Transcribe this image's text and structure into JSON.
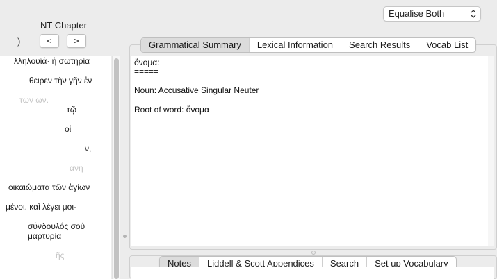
{
  "left": {
    "chapter_title": "NT Chapter",
    "chapter_prefix": ")",
    "prev_label": "<",
    "next_label": ">",
    "verses": [
      {
        "text": "λληλουϊά· ἡ σωτηρία",
        "faded": false
      },
      {
        "text": "θειρεν τὴν γῆν ἐν",
        "faded": false
      },
      {
        "text": "των ων.",
        "faded": false
      },
      {
        "text": "τῷ",
        "faded": false
      },
      {
        "text": "οἱ",
        "faded": false
      },
      {
        "text": "ν,",
        "faded": false
      },
      {
        "text": "ανη",
        "faded": true
      },
      {
        "text": "οικαιώματα τῶν ἁγίων",
        "faded": false
      },
      {
        "text": "μένοι. καὶ λέγει μοι·",
        "faded": false
      },
      {
        "text": "σύνδουλός σού",
        "faded": false
      },
      {
        "text": "μαρτυρία",
        "faded": false
      },
      {
        "text": "ῆς",
        "faded": true
      }
    ]
  },
  "toolbar": {
    "equalise_value": "Equalise Both"
  },
  "top_tabs": [
    {
      "label": "Grammatical Summary",
      "active": true
    },
    {
      "label": "Lexical Information",
      "active": false
    },
    {
      "label": "Search Results",
      "active": false
    },
    {
      "label": "Vocab List",
      "active": false
    }
  ],
  "summary": {
    "word": "ὄνομα:",
    "underline": "=====",
    "parse": "Noun: Accusative Singular Neuter",
    "root": "Root of word: ὄνομα"
  },
  "bottom_tabs": [
    {
      "label": "Notes",
      "active": true
    },
    {
      "label": "Liddell & Scott Appendices",
      "active": false
    },
    {
      "label": "Search",
      "active": false
    },
    {
      "label": "Set up Vocabulary",
      "active": false
    }
  ]
}
